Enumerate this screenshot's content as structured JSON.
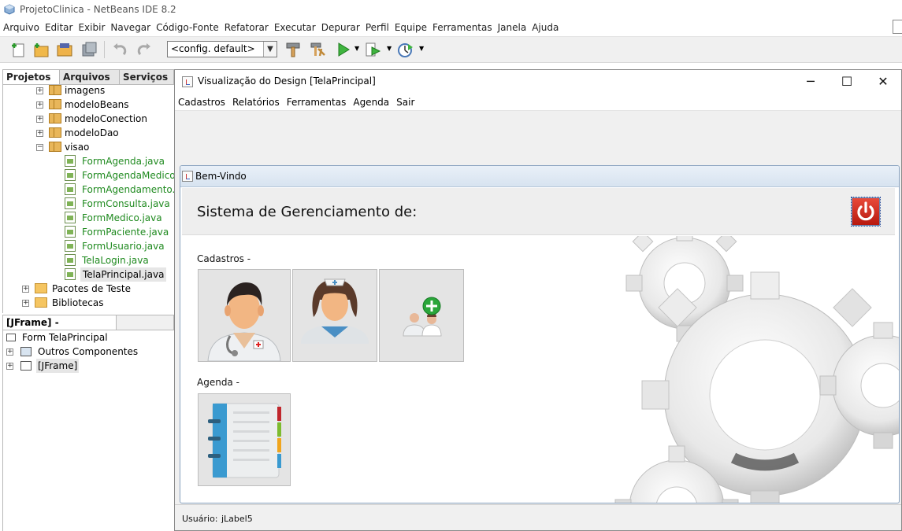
{
  "ide": {
    "title": "ProjetoClinica - NetBeans IDE 8.2",
    "menu": [
      "Arquivo",
      "Editar",
      "Exibir",
      "Navegar",
      "Código-Fonte",
      "Refatorar",
      "Executar",
      "Depurar",
      "Perfil",
      "Equipe",
      "Ferramentas",
      "Janela",
      "Ajuda"
    ],
    "toolbar": {
      "config_combo": "<config. default>"
    },
    "project_tabs": [
      "Projetos",
      "Arquivos",
      "Serviços"
    ],
    "project_tree": {
      "packages": [
        "imagens",
        "modeloBeans",
        "modeloConection",
        "modeloDao",
        "visao"
      ],
      "files": [
        "FormAgenda.java",
        "FormAgendaMedico.java",
        "FormAgendamento.java",
        "FormConsulta.java",
        "FormMedico.java",
        "FormPaciente.java",
        "FormUsuario.java",
        "TelaLogin.java",
        "TelaPrincipal.java"
      ],
      "bottom": [
        "Pacotes de Teste",
        "Bibliotecas"
      ]
    },
    "navigator": {
      "tab": "[JFrame] - Navegador",
      "items": [
        "Form TelaPrincipal",
        "Outros Componentes",
        "[JFrame]"
      ]
    }
  },
  "design_window": {
    "title": "Visualização do Design [TelaPrincipal]",
    "menu": [
      "Cadastros",
      "Relatórios",
      "Ferramentas",
      "Agenda",
      "Sair"
    ],
    "internal_frame": {
      "title": "Bem-Vindo",
      "header": "Sistema de Gerenciamento de:",
      "cadastros_label": "Cadastros -",
      "agenda_label": "Agenda -"
    },
    "status": {
      "user_label": "Usuário:",
      "user_value": "jLabel5"
    }
  }
}
